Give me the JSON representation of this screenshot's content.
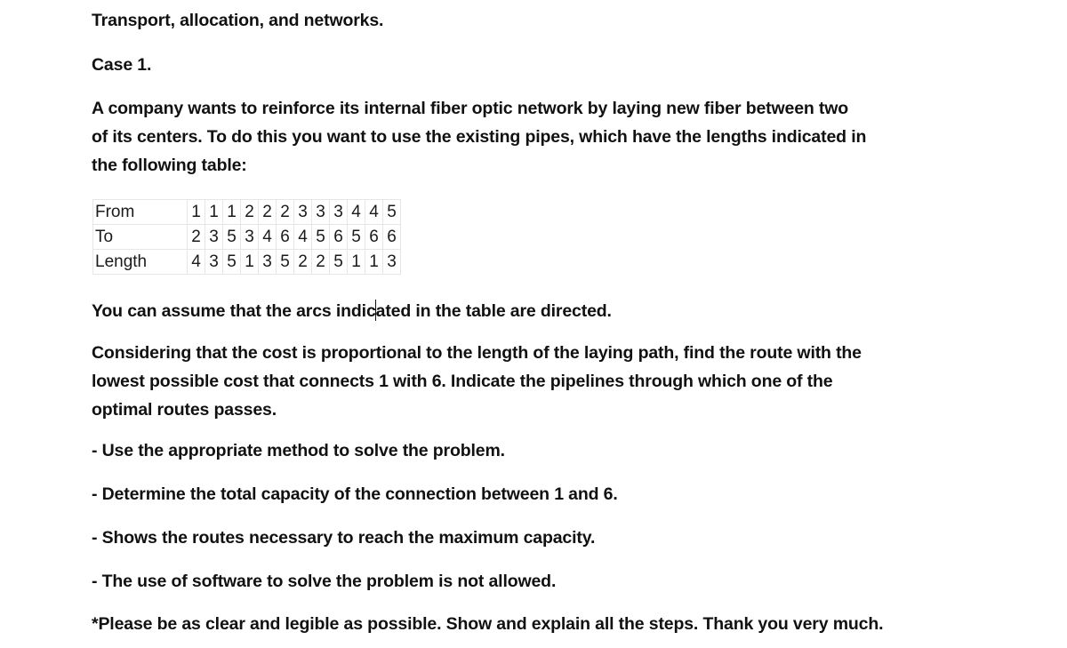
{
  "document": {
    "title": "Transport, allocation, and networks.",
    "case_label": "Case 1.",
    "intro_lines": [
      "A company wants to reinforce its internal fiber optic network by laying new fiber between two",
      "of its centers. To do this you want to use the existing pipes, which have the lengths indicated in",
      "the following table:"
    ],
    "table": {
      "row_labels": [
        "From",
        "To",
        "Length"
      ],
      "from": [
        "1",
        "1",
        "1",
        "2",
        "2",
        "2",
        "3",
        "3",
        "3",
        "4",
        "4",
        "5"
      ],
      "to": [
        "2",
        "3",
        "5",
        "3",
        "4",
        "6",
        "4",
        "5",
        "6",
        "5",
        "6",
        "6"
      ],
      "length": [
        "4",
        "3",
        "5",
        "1",
        "3",
        "5",
        "2",
        "2",
        "5",
        "1",
        "1",
        "3"
      ]
    },
    "directed_note_before_caret": "You can assume that the arcs indic",
    "directed_note_after_caret": "ated in the table are directed.",
    "question_lines": [
      "Considering that the cost is proportional to the length of the laying path, find the route with the",
      "lowest possible cost that connects 1 with 6. Indicate the pipelines through which one of the",
      "optimal routes passes."
    ],
    "bullets": [
      "- Use the appropriate method to solve the problem.",
      "- Determine the total capacity of the connection between 1 and 6.",
      "- Shows the routes necessary to reach the maximum capacity.",
      "- The use of software to solve the problem is not allowed."
    ],
    "closing_note": "*Please be as clear and legible as possible. Show and explain all the steps. Thank you very much."
  }
}
